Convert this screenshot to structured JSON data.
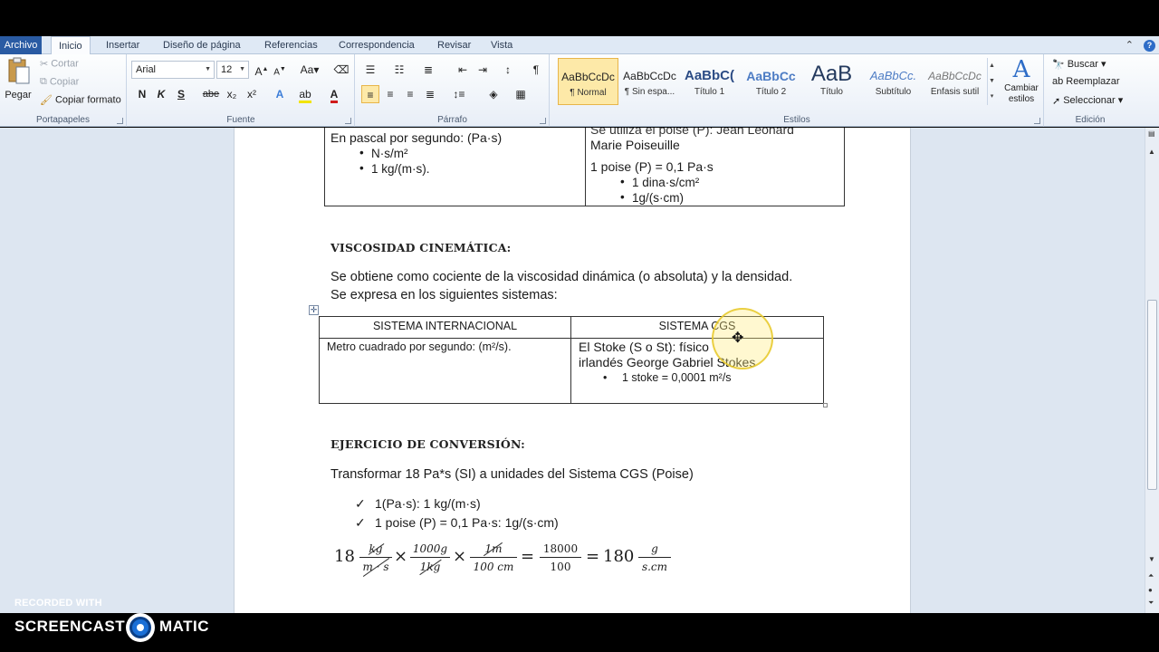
{
  "ribbon_tabs": [
    "Archivo",
    "Inicio",
    "Insertar",
    "Diseño de página",
    "Referencias",
    "Correspondencia",
    "Revisar",
    "Vista"
  ],
  "clipboard": {
    "paste": "Pegar",
    "cut": "Cortar",
    "copy": "Copiar",
    "format_painter": "Copiar formato",
    "group": "Portapapeles"
  },
  "font": {
    "name": "Arial",
    "size": "12",
    "group": "Fuente",
    "bold": "N",
    "italic": "K",
    "underline": "S",
    "strike": "abe",
    "sub": "x₂",
    "sup": "x²"
  },
  "paragraph": {
    "group": "Párrafo"
  },
  "styles": {
    "group": "Estilos",
    "items": [
      {
        "preview": "AaBbCcDc",
        "name": "¶ Normal"
      },
      {
        "preview": "AaBbCcDc",
        "name": "¶ Sin espa..."
      },
      {
        "preview": "AaBbC(",
        "name": "Título 1"
      },
      {
        "preview": "AaBbCc",
        "name": "Título 2"
      },
      {
        "preview": "AaB",
        "name": "Título"
      },
      {
        "preview": "AaBbCc.",
        "name": "Subtítulo"
      },
      {
        "preview": "AaBbCcDc",
        "name": "Énfasis sutil"
      }
    ],
    "change_styles": "Cambiar estilos"
  },
  "editing": {
    "group": "Edición",
    "find": "Buscar",
    "replace": "Reemplazar",
    "select": "Seleccionar"
  },
  "doc": {
    "top_table": {
      "left_line1": "En pascal por segundo:  (Pa·s)",
      "left_b1": "N·s/m²",
      "left_b2": "1 kg/(m·s).",
      "right_line0": "Se  utiliza  el poise (P):  Jean  Leonard",
      "right_line1": "Marie Poiseuille",
      "right_line2": "1 poise (P) = 0,1 Pa·s",
      "right_b1": "1 dina·s/cm²",
      "right_b2": "1g/(s·cm)"
    },
    "heading1": "VISCOSIDAD CINEMÁTICA:",
    "para1": "Se obtiene como cociente de la viscosidad dinámica (o absoluta) y la densidad.",
    "para2": "Se expresa en los siguientes sistemas:",
    "table2": {
      "h1": "SISTEMA INTERNACIONAL",
      "h2": "SISTEMA CGS",
      "c1": "Metro cuadrado por segundo: (m²/s).",
      "c2a": "El Stoke (S o St): físico",
      "c2b": "irlandés George Gabriel Stokes",
      "c2bul": "1 stoke = 0,0001 m²/s"
    },
    "heading2": "EJERCICIO DE CONVERSIÓN:",
    "para3": "Transformar 18 Pa*s (SI) a unidades del Sistema CGS (Poise)",
    "check1": "1(Pa·s): 1 kg/(m·s)",
    "check2": "1 poise (P) = 0,1 Pa·s: 1g/(s·cm)",
    "equation": {
      "lead": "18",
      "f1_num": "kg",
      "f1_den": "m · s",
      "f2_num": "1000g",
      "f2_den": "1kg",
      "f3_num": "1m",
      "f3_den": "100 cm",
      "f4_num": "18000",
      "f4_den": "100",
      "result": "180",
      "f5_num": "g",
      "f5_den": "s.cm",
      "times": "×",
      "equals": "="
    }
  },
  "watermark": {
    "recorded": "RECORDED WITH",
    "left": "SCREENCAST",
    "right": "MATIC"
  }
}
